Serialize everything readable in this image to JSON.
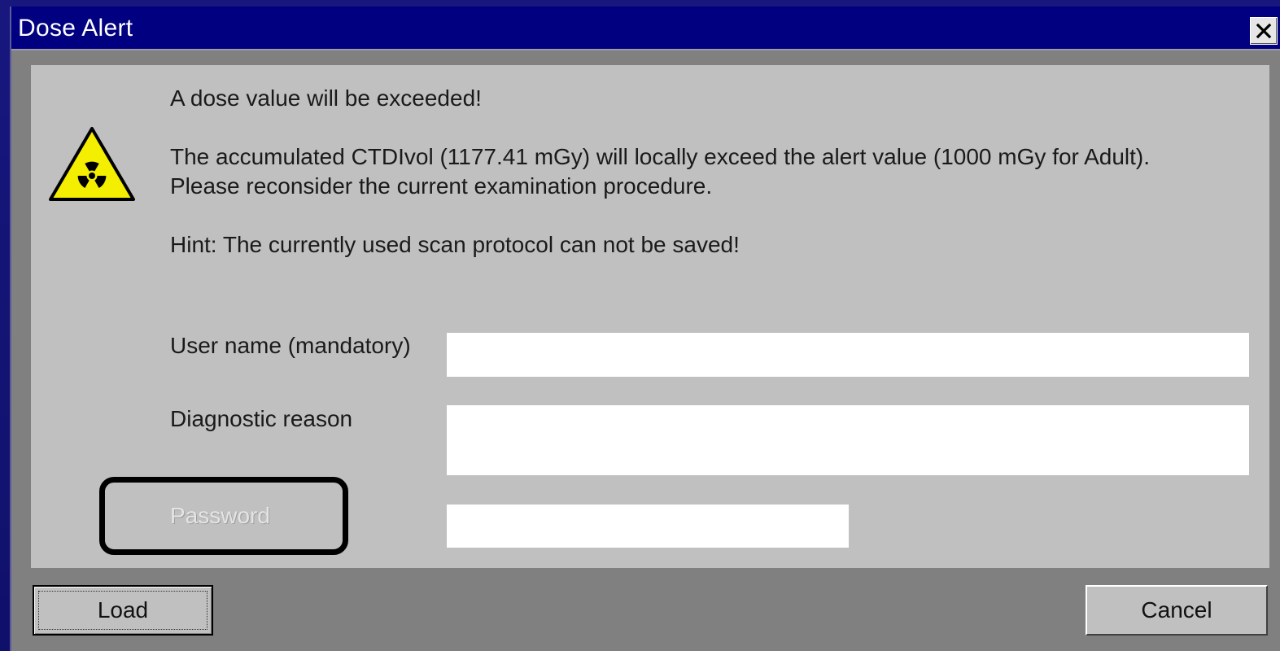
{
  "window": {
    "title": "Dose Alert",
    "close_symbol": "✕"
  },
  "message": {
    "line1": "A dose value will be exceeded!",
    "line2": "The accumulated CTDIvol (1177.41 mGy) will locally exceed the alert value  (1000 mGy for Adult).",
    "line3": "Please reconsider the current examination procedure.",
    "hint": "Hint: The currently used scan protocol can not be saved!",
    "icon": "radiation-warning-icon"
  },
  "form": {
    "username_label": "User name (mandatory)",
    "username_value": "",
    "reason_label": "Diagnostic reason",
    "reason_value": "",
    "password_label": "Password",
    "password_value": ""
  },
  "buttons": {
    "load": "Load",
    "cancel": "Cancel"
  },
  "colors": {
    "titlebar": "#000080",
    "panel": "#c0c0c0",
    "warning_yellow": "#f4ee00",
    "highlight_border": "#000000"
  }
}
